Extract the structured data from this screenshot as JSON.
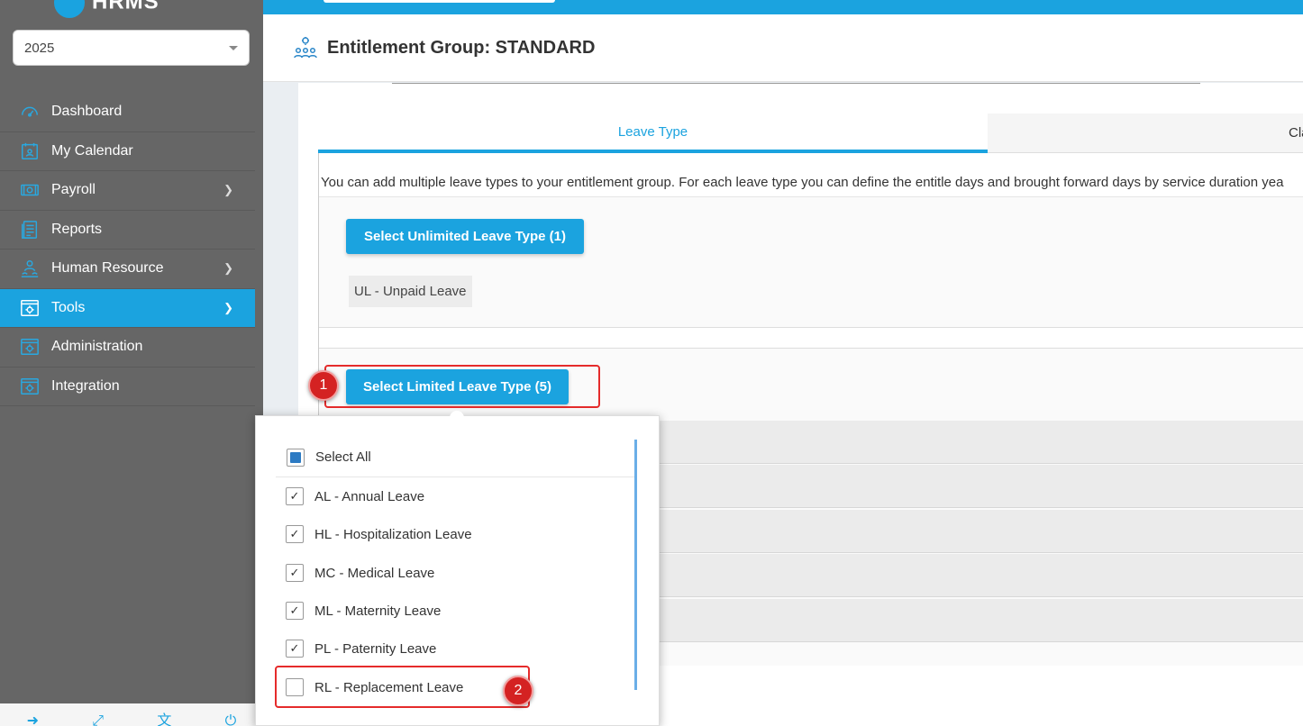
{
  "sidebar": {
    "logo_text": "HRMS",
    "year_select": {
      "value": "2025"
    },
    "items": [
      {
        "label": "Dashboard",
        "icon": "gauge-icon",
        "has_chevron": false,
        "active": false
      },
      {
        "label": "My Calendar",
        "icon": "calendar-person-icon",
        "has_chevron": false,
        "active": false
      },
      {
        "label": "Payroll",
        "icon": "money-icon",
        "has_chevron": true,
        "active": false
      },
      {
        "label": "Reports",
        "icon": "report-icon",
        "has_chevron": false,
        "active": false
      },
      {
        "label": "Human Resource",
        "icon": "people-icon",
        "has_chevron": true,
        "active": false
      },
      {
        "label": "Tools",
        "icon": "tools-window-icon",
        "has_chevron": true,
        "active": true
      },
      {
        "label": "Administration",
        "icon": "admin-window-icon",
        "has_chevron": false,
        "active": false
      },
      {
        "label": "Integration",
        "icon": "integration-window-icon",
        "has_chevron": false,
        "active": false
      }
    ],
    "footer_icons": [
      "logout-icon",
      "fullscreen-icon",
      "translate-icon",
      "power-icon"
    ]
  },
  "header": {
    "icon": "entitlement-group-icon",
    "title": "Entitlement Group: STANDARD"
  },
  "tabs": [
    {
      "label": "Leave Type",
      "active": true
    },
    {
      "label": "Cla",
      "active": false
    }
  ],
  "description": "You can add multiple leave types to your entitlement group. For each leave type you can define the entitle days and brought forward days by service duration yea",
  "unlimited": {
    "button_label": "Select Unlimited Leave Type (1)",
    "items": [
      "UL - Unpaid Leave"
    ]
  },
  "limited": {
    "button_label": "Select Limited Leave Type (5)"
  },
  "dropdown": {
    "select_all_label": "Select All",
    "options": [
      {
        "label": "AL - Annual Leave",
        "checked": true
      },
      {
        "label": "HL - Hospitalization Leave",
        "checked": true
      },
      {
        "label": "MC - Medical Leave",
        "checked": true
      },
      {
        "label": "ML - Maternity Leave",
        "checked": true
      },
      {
        "label": "PL - Paternity Leave",
        "checked": true
      },
      {
        "label": "RL - Replacement Leave",
        "checked": false
      }
    ]
  },
  "annotations": {
    "badge_1": "1",
    "badge_2": "2"
  },
  "colors": {
    "accent": "#1ba3df",
    "sidebar_bg": "#666666",
    "highlight": "#e52b2b",
    "badge": "#d42222"
  }
}
